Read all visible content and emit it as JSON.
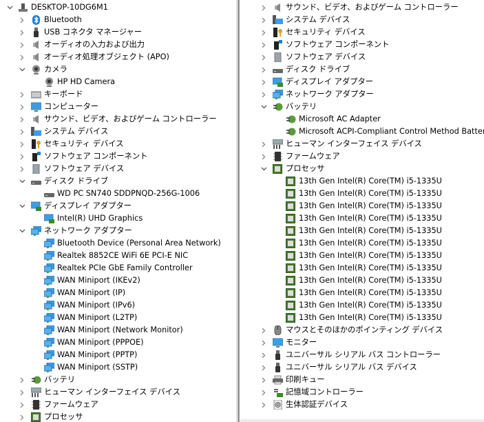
{
  "colors": {
    "accent": "#1e7fd6",
    "cpu": "#4a7a2c",
    "divider": "#9a9a9a"
  },
  "left_tree": [
    {
      "label": "DESKTOP-10DG6M1",
      "icon": "computer-tower-icon",
      "level": 0,
      "state": "open"
    },
    {
      "label": "Bluetooth",
      "icon": "bluetooth-icon",
      "level": 1,
      "state": "closed"
    },
    {
      "label": "USB コネクタ マネージャー",
      "icon": "usb-icon",
      "level": 1,
      "state": "closed"
    },
    {
      "label": "オーディオの入力および出力",
      "icon": "speaker-icon",
      "level": 1,
      "state": "closed"
    },
    {
      "label": "オーディオ処理オブジェクト (APO)",
      "icon": "speaker-icon",
      "level": 1,
      "state": "closed"
    },
    {
      "label": "カメラ",
      "icon": "webcam-icon",
      "level": 1,
      "state": "open"
    },
    {
      "label": "HP HD Camera",
      "icon": "webcam-icon",
      "level": 2,
      "state": "none"
    },
    {
      "label": "キーボード",
      "icon": "keyboard-icon",
      "level": 1,
      "state": "closed"
    },
    {
      "label": "コンピューター",
      "icon": "monitor-icon",
      "level": 1,
      "state": "closed"
    },
    {
      "label": "サウンド、ビデオ、およびゲーム コントローラー",
      "icon": "speaker-icon",
      "level": 1,
      "state": "closed"
    },
    {
      "label": "システム デバイス",
      "icon": "system-device-icon",
      "level": 1,
      "state": "closed"
    },
    {
      "label": "セキュリティ デバイス",
      "icon": "security-key-icon",
      "level": 1,
      "state": "closed"
    },
    {
      "label": "ソフトウェア コンポーネント",
      "icon": "software-component-icon",
      "level": 1,
      "state": "closed"
    },
    {
      "label": "ソフトウェア デバイス",
      "icon": "software-device-icon",
      "level": 1,
      "state": "closed"
    },
    {
      "label": "ディスク ドライブ",
      "icon": "disk-drive-icon",
      "level": 1,
      "state": "open"
    },
    {
      "label": "WD PC SN740 SDDPNQD-256G-1006",
      "icon": "disk-drive-icon",
      "level": 2,
      "state": "none"
    },
    {
      "label": "ディスプレイ アダプター",
      "icon": "display-adapter-icon",
      "level": 1,
      "state": "open"
    },
    {
      "label": "Intel(R) UHD Graphics",
      "icon": "display-adapter-icon",
      "level": 2,
      "state": "none"
    },
    {
      "label": "ネットワーク アダプター",
      "icon": "network-adapter-icon",
      "level": 1,
      "state": "open"
    },
    {
      "label": "Bluetooth Device (Personal Area Network)",
      "icon": "network-adapter-icon",
      "level": 2,
      "state": "none"
    },
    {
      "label": "Realtek 8852CE WiFi 6E PCI-E NIC",
      "icon": "network-adapter-icon",
      "level": 2,
      "state": "none"
    },
    {
      "label": "Realtek PCIe GbE Family Controller",
      "icon": "network-adapter-icon",
      "level": 2,
      "state": "none"
    },
    {
      "label": "WAN Miniport (IKEv2)",
      "icon": "network-adapter-icon",
      "level": 2,
      "state": "none"
    },
    {
      "label": "WAN Miniport (IP)",
      "icon": "network-adapter-icon",
      "level": 2,
      "state": "none"
    },
    {
      "label": "WAN Miniport (IPv6)",
      "icon": "network-adapter-icon",
      "level": 2,
      "state": "none"
    },
    {
      "label": "WAN Miniport (L2TP)",
      "icon": "network-adapter-icon",
      "level": 2,
      "state": "none"
    },
    {
      "label": "WAN Miniport (Network Monitor)",
      "icon": "network-adapter-icon",
      "level": 2,
      "state": "none"
    },
    {
      "label": "WAN Miniport (PPPOE)",
      "icon": "network-adapter-icon",
      "level": 2,
      "state": "none"
    },
    {
      "label": "WAN Miniport (PPTP)",
      "icon": "network-adapter-icon",
      "level": 2,
      "state": "none"
    },
    {
      "label": "WAN Miniport (SSTP)",
      "icon": "network-adapter-icon",
      "level": 2,
      "state": "none"
    },
    {
      "label": "バッテリ",
      "icon": "battery-icon",
      "level": 1,
      "state": "closed"
    },
    {
      "label": "ヒューマン インターフェイス デバイス",
      "icon": "hid-icon",
      "level": 1,
      "state": "closed"
    },
    {
      "label": "ファームウェア",
      "icon": "firmware-icon",
      "level": 1,
      "state": "closed"
    },
    {
      "label": "プロセッサ",
      "icon": "processor-icon",
      "level": 1,
      "state": "closed"
    }
  ],
  "right_tree": [
    {
      "label": "サウンド、ビデオ、およびゲーム コントローラー",
      "icon": "speaker-icon",
      "level": 1,
      "state": "closed"
    },
    {
      "label": "システム デバイス",
      "icon": "system-device-icon",
      "level": 1,
      "state": "closed"
    },
    {
      "label": "セキュリティ デバイス",
      "icon": "security-key-icon",
      "level": 1,
      "state": "closed"
    },
    {
      "label": "ソフトウェア コンポーネント",
      "icon": "software-component-icon",
      "level": 1,
      "state": "closed"
    },
    {
      "label": "ソフトウェア デバイス",
      "icon": "software-device-icon",
      "level": 1,
      "state": "closed"
    },
    {
      "label": "ディスク ドライブ",
      "icon": "disk-drive-icon",
      "level": 1,
      "state": "closed"
    },
    {
      "label": "ディスプレイ アダプター",
      "icon": "display-adapter-icon",
      "level": 1,
      "state": "closed"
    },
    {
      "label": "ネットワーク アダプター",
      "icon": "network-adapter-icon",
      "level": 1,
      "state": "closed"
    },
    {
      "label": "バッテリ",
      "icon": "battery-icon",
      "level": 1,
      "state": "open"
    },
    {
      "label": "Microsoft AC Adapter",
      "icon": "battery-icon",
      "level": 2,
      "state": "none"
    },
    {
      "label": "Microsoft ACPI-Compliant Control Method Battery",
      "icon": "battery-icon",
      "level": 2,
      "state": "none"
    },
    {
      "label": "ヒューマン インターフェイス デバイス",
      "icon": "hid-icon",
      "level": 1,
      "state": "closed"
    },
    {
      "label": "ファームウェア",
      "icon": "firmware-icon",
      "level": 1,
      "state": "closed"
    },
    {
      "label": "プロセッサ",
      "icon": "processor-icon",
      "level": 1,
      "state": "open"
    },
    {
      "label": "13th Gen Intel(R) Core(TM) i5-1335U",
      "icon": "processor-icon",
      "level": 2,
      "state": "none"
    },
    {
      "label": "13th Gen Intel(R) Core(TM) i5-1335U",
      "icon": "processor-icon",
      "level": 2,
      "state": "none"
    },
    {
      "label": "13th Gen Intel(R) Core(TM) i5-1335U",
      "icon": "processor-icon",
      "level": 2,
      "state": "none"
    },
    {
      "label": "13th Gen Intel(R) Core(TM) i5-1335U",
      "icon": "processor-icon",
      "level": 2,
      "state": "none"
    },
    {
      "label": "13th Gen Intel(R) Core(TM) i5-1335U",
      "icon": "processor-icon",
      "level": 2,
      "state": "none"
    },
    {
      "label": "13th Gen Intel(R) Core(TM) i5-1335U",
      "icon": "processor-icon",
      "level": 2,
      "state": "none"
    },
    {
      "label": "13th Gen Intel(R) Core(TM) i5-1335U",
      "icon": "processor-icon",
      "level": 2,
      "state": "none"
    },
    {
      "label": "13th Gen Intel(R) Core(TM) i5-1335U",
      "icon": "processor-icon",
      "level": 2,
      "state": "none"
    },
    {
      "label": "13th Gen Intel(R) Core(TM) i5-1335U",
      "icon": "processor-icon",
      "level": 2,
      "state": "none"
    },
    {
      "label": "13th Gen Intel(R) Core(TM) i5-1335U",
      "icon": "processor-icon",
      "level": 2,
      "state": "none"
    },
    {
      "label": "13th Gen Intel(R) Core(TM) i5-1335U",
      "icon": "processor-icon",
      "level": 2,
      "state": "none"
    },
    {
      "label": "13th Gen Intel(R) Core(TM) i5-1335U",
      "icon": "processor-icon",
      "level": 2,
      "state": "none"
    },
    {
      "label": "マウスとそのほかのポインティング デバイス",
      "icon": "mouse-icon",
      "level": 1,
      "state": "closed"
    },
    {
      "label": "モニター",
      "icon": "monitor-icon",
      "level": 1,
      "state": "closed"
    },
    {
      "label": "ユニバーサル シリアル バス コントローラー",
      "icon": "usb-icon",
      "level": 1,
      "state": "closed"
    },
    {
      "label": "ユニバーサル シリアル バス デバイス",
      "icon": "usb-icon",
      "level": 1,
      "state": "closed"
    },
    {
      "label": "印刷キュー",
      "icon": "printer-icon",
      "level": 1,
      "state": "closed"
    },
    {
      "label": "記憶域コントローラー",
      "icon": "storage-controller-icon",
      "level": 1,
      "state": "closed"
    },
    {
      "label": "生体認証デバイス",
      "icon": "fingerprint-icon",
      "level": 1,
      "state": "closed"
    }
  ]
}
